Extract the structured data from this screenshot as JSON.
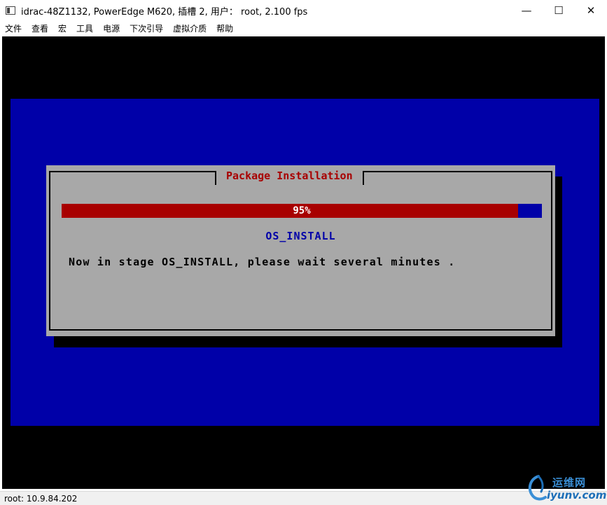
{
  "window": {
    "title": "idrac-48Z1132, PowerEdge M620, 插槽 2, 用户： root, 2.100 fps",
    "minimize_glyph": "—",
    "maximize_glyph": "☐",
    "close_glyph": "✕"
  },
  "menu": {
    "items": [
      "文件",
      "查看",
      "宏",
      "工具",
      "电源",
      "下次引导",
      "虚拟介质",
      "帮助"
    ]
  },
  "dialog": {
    "title": "Package Installation",
    "progress_label": "95%",
    "progress_fraction": 0.95,
    "stage": "OS_INSTALL",
    "message": "Now in stage OS_INSTALL, please wait several minutes ."
  },
  "status": {
    "text": "root: 10.9.84.202"
  },
  "watermark": {
    "cn": "运维网",
    "en": "iyunv.com"
  },
  "colors": {
    "console_bg": "#000000",
    "screen_blue": "#0000a8",
    "dialog_gray": "#a8a8a8",
    "progress_red": "#a80000",
    "title_red": "#a80000"
  }
}
